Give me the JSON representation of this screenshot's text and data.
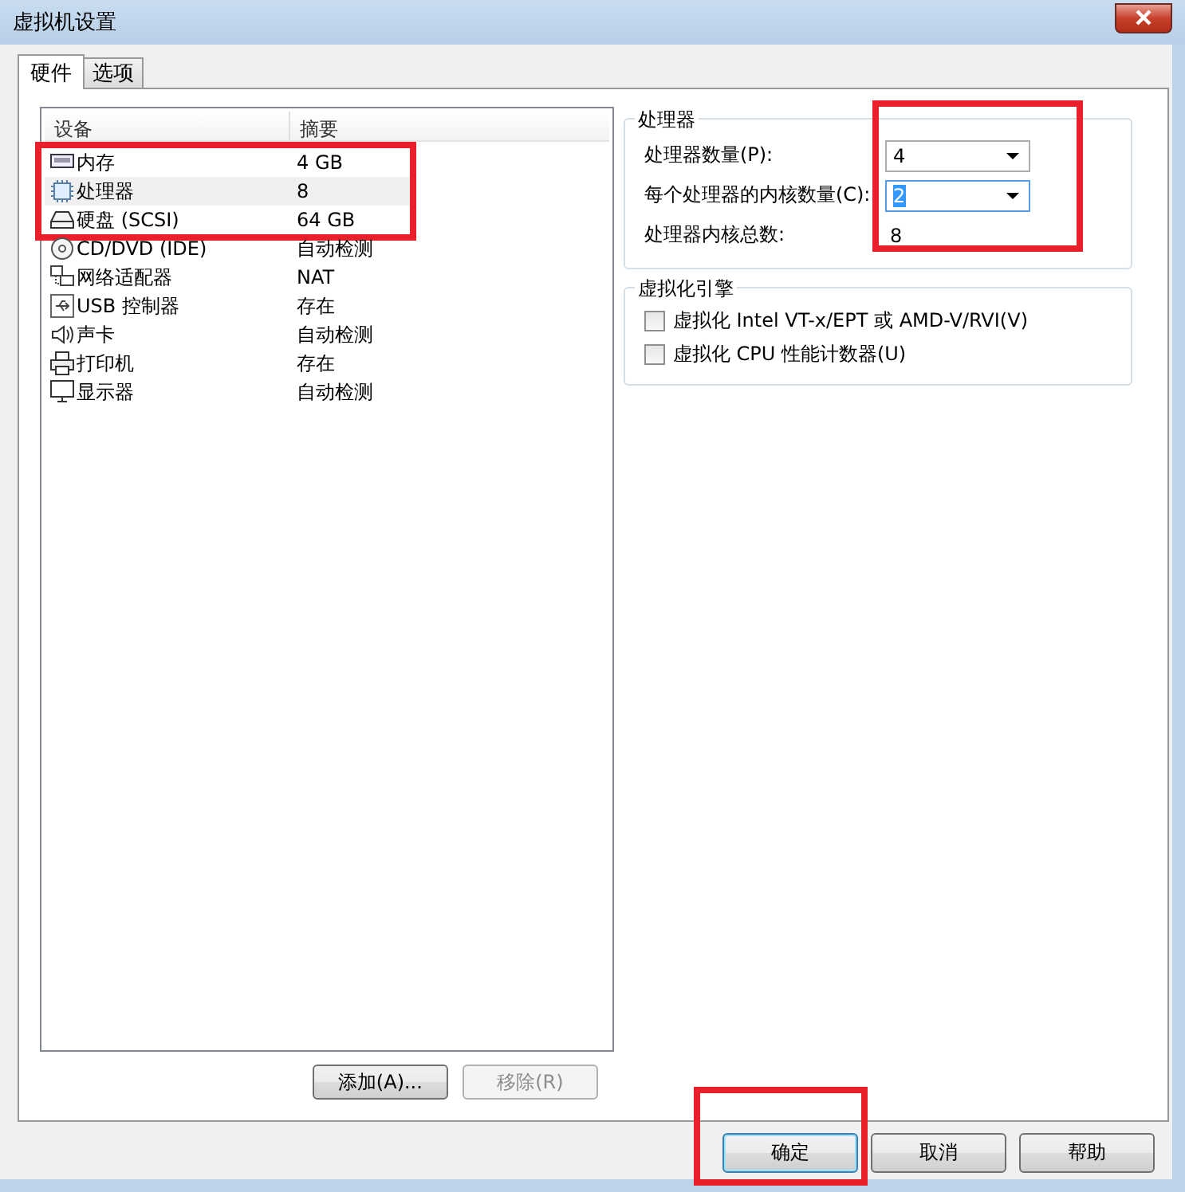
{
  "window": {
    "title": "虚拟机设置"
  },
  "tabs": [
    {
      "label": "硬件",
      "selected": true
    },
    {
      "label": "选项",
      "selected": false
    }
  ],
  "device_table": {
    "columns": [
      "设备",
      "摘要"
    ],
    "rows": [
      {
        "kind": "memory",
        "device": "内存",
        "summary": "4 GB",
        "selected": false,
        "highlighted": true
      },
      {
        "kind": "cpu",
        "device": "处理器",
        "summary": "8",
        "selected": true,
        "highlighted": true
      },
      {
        "kind": "disk",
        "device": "硬盘 (SCSI)",
        "summary": "64 GB",
        "selected": false,
        "highlighted": true
      },
      {
        "kind": "cd",
        "device": "CD/DVD (IDE)",
        "summary": "自动检测",
        "selected": false,
        "highlighted": false
      },
      {
        "kind": "network",
        "device": "网络适配器",
        "summary": "NAT",
        "selected": false,
        "highlighted": false
      },
      {
        "kind": "usb",
        "device": "USB 控制器",
        "summary": "存在",
        "selected": false,
        "highlighted": false
      },
      {
        "kind": "sound",
        "device": "声卡",
        "summary": "自动检测",
        "selected": false,
        "highlighted": false
      },
      {
        "kind": "printer",
        "device": "打印机",
        "summary": "存在",
        "selected": false,
        "highlighted": false
      },
      {
        "kind": "display",
        "device": "显示器",
        "summary": "自动检测",
        "selected": false,
        "highlighted": false
      }
    ]
  },
  "device_buttons": [
    {
      "label": "添加(A)...",
      "disabled": false
    },
    {
      "label": "移除(R)",
      "disabled": true
    }
  ],
  "processor": {
    "title": "处理器",
    "highlighted": true,
    "fields": [
      {
        "kind": "combo",
        "label": "处理器数量(P):",
        "value": "4",
        "focused": false
      },
      {
        "kind": "combo",
        "label": "每个处理器的内核数量(C):",
        "value": "2",
        "focused": true
      },
      {
        "kind": "readout",
        "label": "处理器内核总数:",
        "value": "8"
      }
    ]
  },
  "virtualization": {
    "title": "虚拟化引擎",
    "options": [
      {
        "label": "虚拟化 Intel VT-x/EPT 或 AMD-V/RVI(V)",
        "checked": false
      },
      {
        "label": "虚拟化 CPU 性能计数器(U)",
        "checked": false
      }
    ]
  },
  "dialog_buttons": [
    {
      "label": "确定",
      "default": true,
      "highlighted": true
    },
    {
      "label": "取消",
      "default": false,
      "highlighted": false
    },
    {
      "label": "帮助",
      "default": false,
      "highlighted": false
    }
  ]
}
